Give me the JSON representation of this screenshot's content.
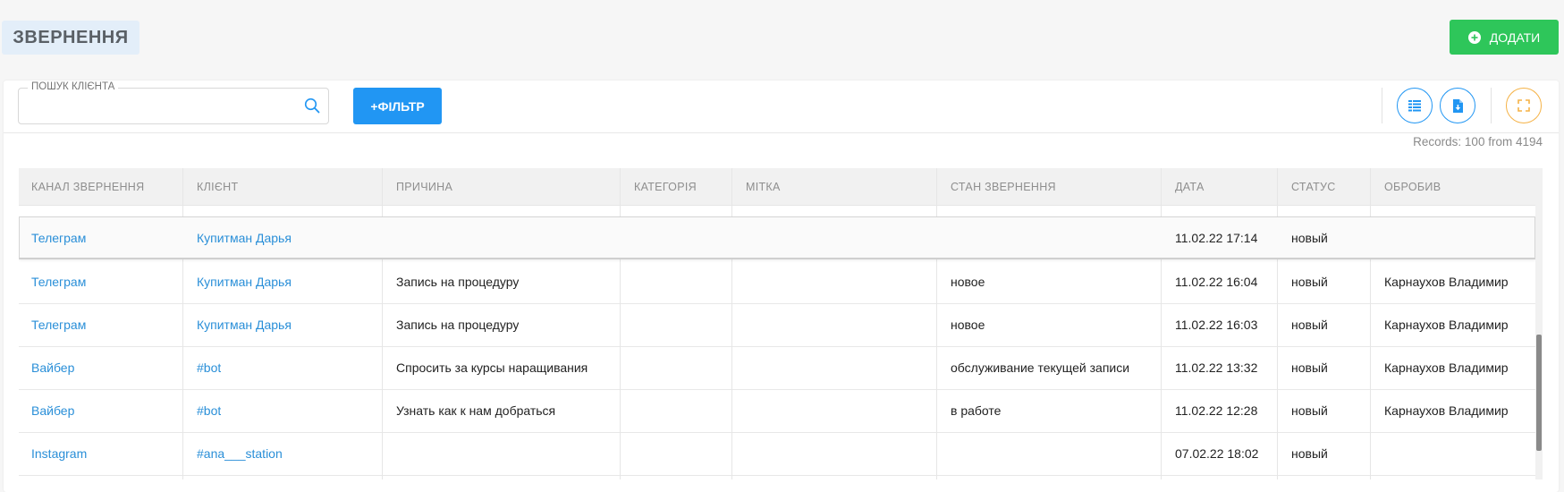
{
  "header": {
    "title": "ЗВЕРНЕННЯ",
    "add_label": "ДОДАТИ"
  },
  "toolbar": {
    "search_label": "ПОШУК КЛІЄНТА",
    "search_value": "",
    "filter_label": "+ФІЛЬТР",
    "records_text": "Records: 100 from 4194"
  },
  "table": {
    "columns": [
      "КАНАЛ ЗВЕРНЕННЯ",
      "КЛІЄНТ",
      "ПРИЧИНА",
      "КАТЕГОРІЯ",
      "МІТКА",
      "СТАН ЗВЕРНЕННЯ",
      "ДАТА",
      "СТАТУС",
      "ОБРОБИВ"
    ],
    "frozen_row": {
      "channel": "Телеграм",
      "client": "Купитман Дарья",
      "reason": "",
      "category": "",
      "tag": "",
      "state": "",
      "date": "11.02.22 17:14",
      "status": "новый",
      "handled_by": ""
    },
    "rows": [
      {
        "channel": "Телеграм",
        "client": "Купитман Дарья",
        "reason": "Запись на процедуру",
        "category": "",
        "tag": "",
        "state": "новое",
        "date": "11.02.22 16:04",
        "status": "новый",
        "handled_by": "Карнаухов Владимир"
      },
      {
        "channel": "Телеграм",
        "client": "Купитман Дарья",
        "reason": "Запись на процедуру",
        "category": "",
        "tag": "",
        "state": "новое",
        "date": "11.02.22 16:03",
        "status": "новый",
        "handled_by": "Карнаухов Владимир"
      },
      {
        "channel": "Вайбер",
        "client": "#bot",
        "reason": "Спросить за курсы наращивания",
        "category": "",
        "tag": "",
        "state": "обслуживание текущей записи",
        "date": "11.02.22 13:32",
        "status": "новый",
        "handled_by": "Карнаухов Владимир"
      },
      {
        "channel": "Вайбер",
        "client": "#bot",
        "reason": "Узнать как к нам добраться",
        "category": "",
        "tag": "",
        "state": "в работе",
        "date": "11.02.22 12:28",
        "status": "новый",
        "handled_by": "Карнаухов Владимир"
      },
      {
        "channel": "Instagram",
        "client": "#ana___station",
        "reason": "",
        "category": "",
        "tag": "",
        "state": "",
        "date": "07.02.22 18:02",
        "status": "новый",
        "handled_by": ""
      }
    ]
  },
  "icons": {
    "add": "plus-circle-icon",
    "search": "search-icon",
    "columns": "columns-icon",
    "export": "file-download-icon",
    "fullscreen": "fullscreen-icon"
  },
  "colors": {
    "add_button": "#2ec65a",
    "filter_button": "#2196f3",
    "link": "#2a8fd8",
    "fullscreen_accent": "#f5b246"
  }
}
